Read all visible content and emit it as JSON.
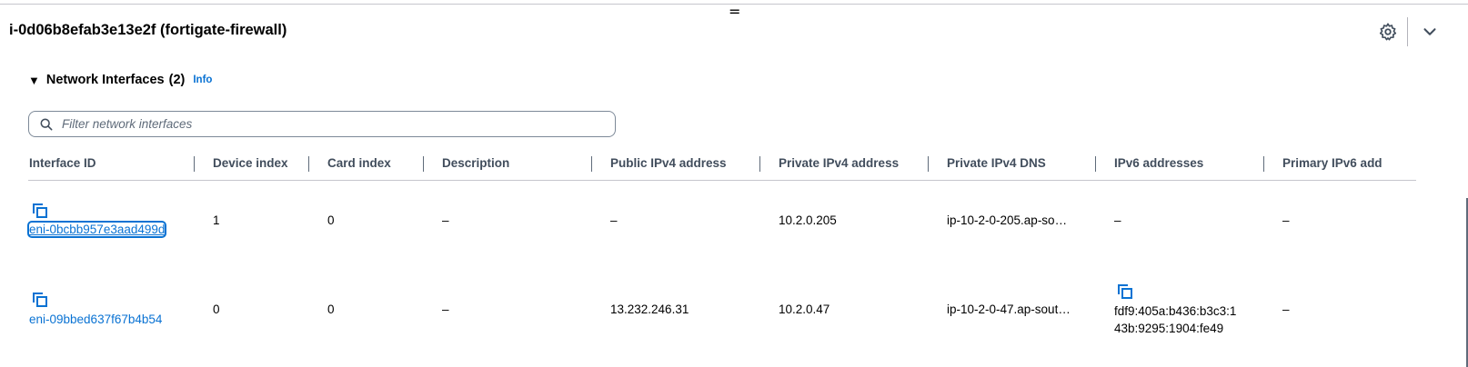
{
  "panel": {
    "handle_glyph": "=",
    "title": "i-0d06b8efab3e13e2f (fortigate-firewall)",
    "settings_icon": "gear-icon",
    "collapse_icon": "chevron-down-icon"
  },
  "section": {
    "caret_glyph": "▼",
    "title": "Network Interfaces",
    "count": "(2)",
    "info_label": "Info"
  },
  "search": {
    "placeholder": "Filter network interfaces",
    "value": ""
  },
  "table": {
    "columns": [
      "Interface ID",
      "Device index",
      "Card index",
      "Description",
      "Public IPv4 address",
      "Private IPv4 address",
      "Private IPv4 DNS",
      "IPv6 addresses",
      "Primary IPv6 add"
    ],
    "rows": [
      {
        "interface_id": "eni-0bcbb957e3aad499d",
        "device_index": "1",
        "card_index": "0",
        "description": "–",
        "public_ipv4": "–",
        "private_ipv4": "10.2.0.205",
        "private_dns": "ip-10-2-0-205.ap-so…",
        "ipv6_line1": "–",
        "ipv6_line2": "",
        "primary_ipv6": "–"
      },
      {
        "interface_id": "eni-09bbed637f67b4b54",
        "device_index": "0",
        "card_index": "0",
        "description": "–",
        "public_ipv4": "13.232.246.31",
        "private_ipv4": "10.2.0.47",
        "private_dns": "ip-10-2-0-47.ap-sout…",
        "ipv6_line1": "fdf9:405a:b436:b3c3:1",
        "ipv6_line2": "43b:9295:1904:fe49",
        "primary_ipv6": "–"
      }
    ]
  },
  "colors": {
    "link": "#0972d3",
    "header_text": "#414d5c",
    "border": "#c6c6cd"
  }
}
